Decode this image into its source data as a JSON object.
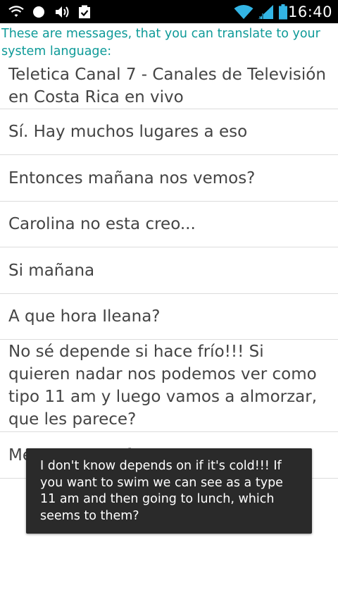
{
  "status_bar": {
    "time": "16:40",
    "icons_left": [
      "wifi-icon",
      "notification-dot-icon",
      "volume-icon",
      "clipboard-check-icon"
    ],
    "icons_right": [
      "wifi-signal-icon",
      "cell-signal-icon",
      "battery-icon"
    ]
  },
  "header": {
    "text": "These are messages, that you can translate to your system language:"
  },
  "messages": [
    "Teletica Canal 7 - Canales de Televisión en Costa Rica en vivo",
    "Sí. Hay muchos lugares a eso",
    "Entonces mañana nos vemos?",
    "Carolina no esta creo...",
    "Si mañana",
    "A que hora Ileana?",
    "No sé depende si hace frío!!! Si quieren nadar nos podemos ver como tipo 11 am y luego vamos a almorzar, que les parece?",
    "Me parece perfecto"
  ],
  "toast": {
    "text": "I don't know depends on if it's cold!!! If you want to swim we can see as a type 11 am and then going to lunch, which seems to them?"
  },
  "colors": {
    "header": "#0e9a98",
    "item_text": "#444444",
    "divider": "#dcdcdc",
    "toast_bg": "#2a2a2a",
    "status_bar_bg": "#000000",
    "status_accent": "#33b5e5"
  }
}
